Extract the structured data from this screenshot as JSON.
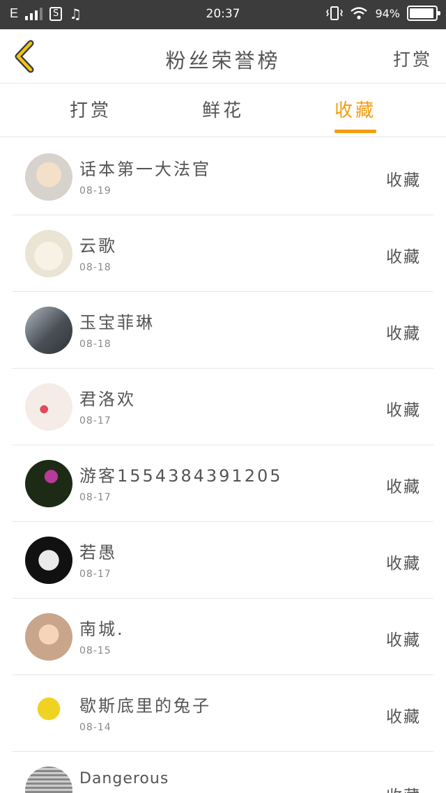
{
  "status_bar": {
    "carrier": "E",
    "sim_icon": "S",
    "music_icon": "♫",
    "time": "20:37",
    "battery_text": "94%",
    "battery_level": 0.94
  },
  "header": {
    "title": "粉丝荣誉榜",
    "action": "打赏"
  },
  "tabs": [
    {
      "label": "打赏"
    },
    {
      "label": "鲜花"
    },
    {
      "label": "收藏"
    }
  ],
  "list": [
    {
      "name": "话本第一大法官",
      "date": "08-19",
      "action": "收藏"
    },
    {
      "name": "云歌",
      "date": "08-18",
      "action": "收藏"
    },
    {
      "name": "玉宝菲琳",
      "date": "08-18",
      "action": "收藏"
    },
    {
      "name": "君洛欢",
      "date": "08-17",
      "action": "收藏"
    },
    {
      "name": "游客1554384391205",
      "date": "08-17",
      "action": "收藏"
    },
    {
      "name": "若愚",
      "date": "08-17",
      "action": "收藏"
    },
    {
      "name": "南城.",
      "date": "08-15",
      "action": "收藏"
    },
    {
      "name": "歇斯底里的兔子",
      "date": "08-14",
      "action": "收藏"
    },
    {
      "name": "Dangerous",
      "date": "",
      "action": "收藏"
    }
  ],
  "colors": {
    "accent": "#f39c12",
    "back_icon": "#f0c419"
  }
}
